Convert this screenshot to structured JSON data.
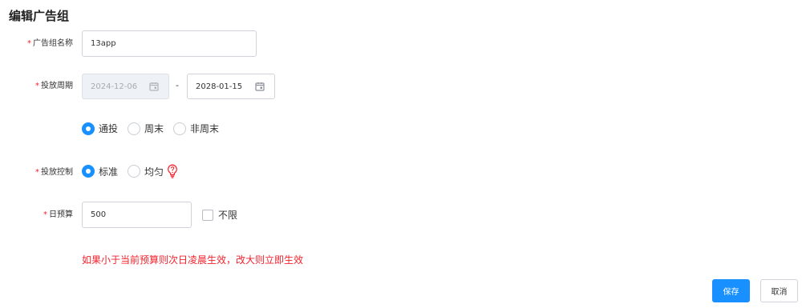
{
  "page": {
    "title": "编辑广告组"
  },
  "form": {
    "name": {
      "label": "广告组名称",
      "value": "13app"
    },
    "period": {
      "label": "投放周期",
      "start_date": "2024-12-06",
      "separator": "-",
      "end_date": "2028-01-15",
      "day_options": [
        {
          "label": "通投",
          "selected": true
        },
        {
          "label": "周末",
          "selected": false
        },
        {
          "label": "非周末",
          "selected": false
        }
      ]
    },
    "control": {
      "label": "投放控制",
      "options": [
        {
          "label": "标准",
          "selected": true
        },
        {
          "label": "均匀",
          "selected": false
        }
      ],
      "hint_icon": "lightbulb-icon"
    },
    "budget": {
      "label": "日预算",
      "value": "500",
      "unlimited_label": "不限",
      "unlimited_checked": false
    },
    "notice": "如果小于当前预算则次日凌晨生效，改大则立即生效"
  },
  "actions": {
    "save_label": "保存",
    "cancel_label": "取消"
  },
  "colors": {
    "primary": "#1890ff",
    "required": "#f5222d",
    "notice": "#f5222d",
    "hint_icon": "#f5222d"
  }
}
